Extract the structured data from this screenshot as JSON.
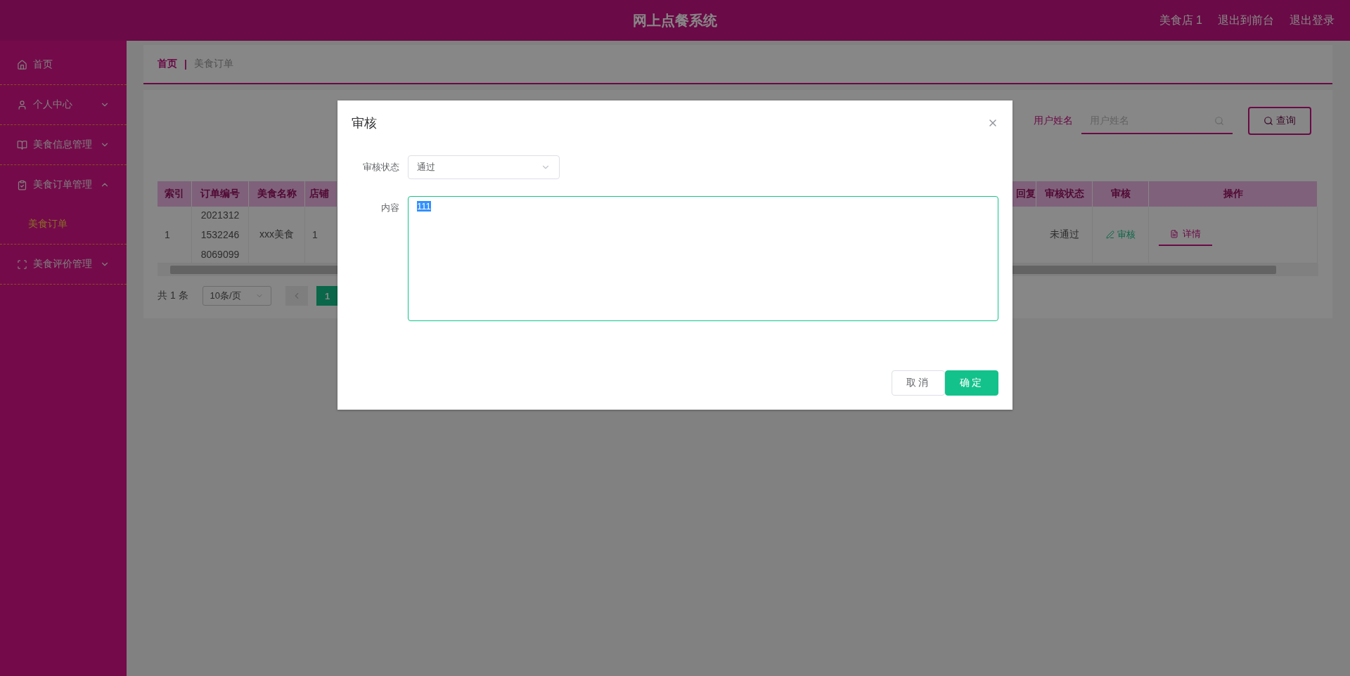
{
  "header": {
    "title": "网上点餐系统",
    "links": [
      "美食店 1",
      "退出到前台",
      "退出登录"
    ]
  },
  "sidebar": {
    "items": [
      {
        "label": "首页",
        "kind": "home",
        "selected": false
      },
      {
        "label": "个人中心",
        "kind": "user",
        "selected": false,
        "expanded": false
      },
      {
        "label": "美食信息管理",
        "kind": "book",
        "selected": false,
        "expanded": false
      },
      {
        "label": "美食订单管理",
        "kind": "clipboard",
        "selected": false,
        "expanded": true,
        "children": [
          {
            "label": "美食订单",
            "selected": true
          }
        ]
      },
      {
        "label": "美食评价管理",
        "kind": "scan",
        "selected": false,
        "expanded": false
      }
    ]
  },
  "breadcrumb": [
    {
      "label": "首页",
      "current": false
    },
    {
      "separator": "|",
      "label": "美食订单",
      "current": true
    }
  ],
  "search": {
    "label": "用户姓名",
    "placeholder": "用户姓名",
    "button": "查询"
  },
  "table": {
    "columns": [
      "索引",
      "订单编号",
      "美食名称",
      "店铺",
      "回复",
      "审核状态",
      "审核",
      "操作"
    ],
    "rows": [
      {
        "index": "1",
        "order_no": "202131215322468069099",
        "food_name": "xxx美食",
        "column_4": "1",
        "status": "未通过",
        "review_action": "审核",
        "detail_action": "详情"
      }
    ]
  },
  "pagination": {
    "total": "共 1 条",
    "page_size": "10条/页",
    "pages": [
      {
        "label": "1",
        "selected": true
      }
    ]
  },
  "dialog": {
    "title": "审核",
    "fields": [
      {
        "kind": "select",
        "label": "审核状态",
        "value": "通过"
      },
      {
        "kind": "textarea",
        "label": "内容",
        "value": "111",
        "value_selected": true
      }
    ],
    "buttons": [
      {
        "label": "取消",
        "kind": "default"
      },
      {
        "label": "确定",
        "kind": "primary"
      }
    ]
  }
}
